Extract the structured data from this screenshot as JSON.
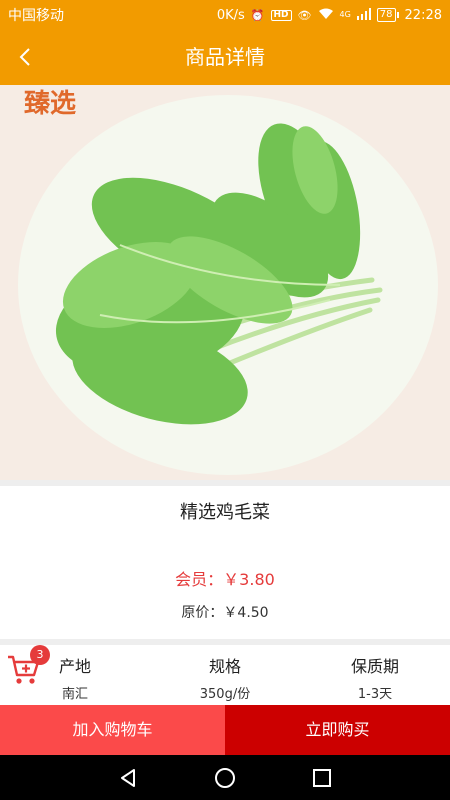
{
  "status_bar": {
    "carrier": "中国移动",
    "speed": "0K/s",
    "hd": "HD",
    "network": "4G",
    "battery": "78",
    "time": "22:28"
  },
  "header": {
    "title": "商品详情"
  },
  "product": {
    "brand_mark": "臻选",
    "name": "精选鸡毛菜",
    "member_price": "会员：￥3.80",
    "original_price": "原价：￥4.50"
  },
  "cart": {
    "badge_count": "3"
  },
  "specs": [
    {
      "label": "产地",
      "value": "南汇"
    },
    {
      "label": "规格",
      "value": "350g/份"
    },
    {
      "label": "保质期",
      "value": "1-3天"
    }
  ],
  "actions": {
    "add_to_cart": "加入购物车",
    "buy_now": "立即购买"
  },
  "colors": {
    "header": "#f29b00",
    "member_price": "#e53b3b",
    "add_button": "#fb4a4a",
    "buy_button": "#cc0000"
  },
  "icons": {
    "back": "chevron-left-icon",
    "cart": "cart-add-icon",
    "nav_back": "triangle-back-icon",
    "nav_home": "circle-home-icon",
    "nav_recent": "square-recent-icon"
  }
}
